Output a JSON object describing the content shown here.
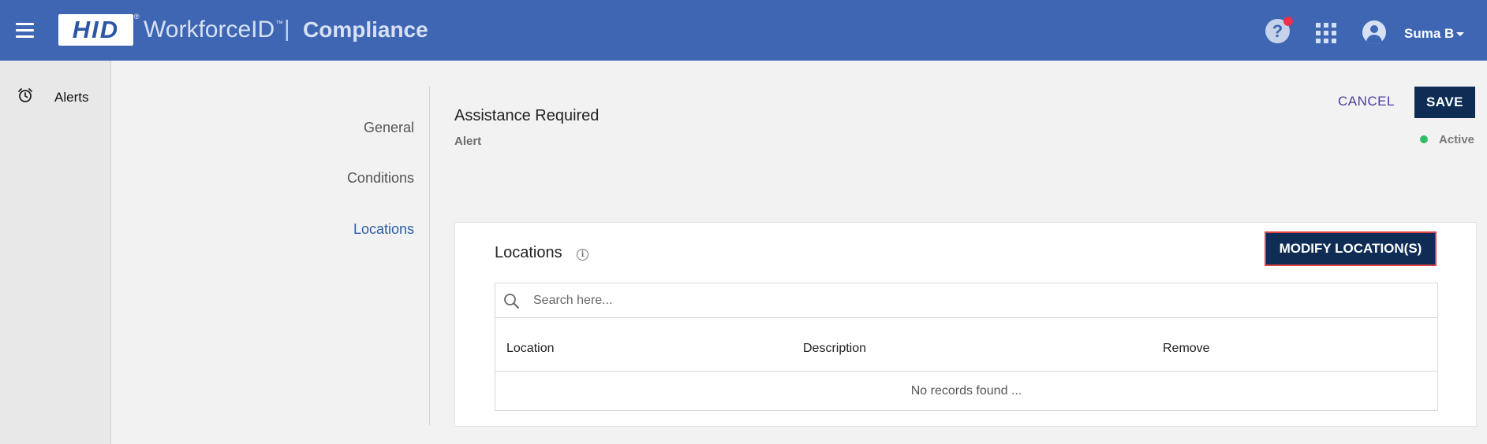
{
  "header": {
    "logo_text": "HID",
    "logo_reg": "®",
    "brand": "WorkforceID",
    "brand_tm": "™",
    "separator": "|",
    "module": "Compliance",
    "help_glyph": "?",
    "user_name": "Suma B",
    "colors": {
      "bar": "#3e66b3",
      "notification": "#ee2e4b"
    }
  },
  "sidebar": {
    "items": [
      {
        "label": "Alerts",
        "icon": "alarm-clock-icon"
      }
    ]
  },
  "section_nav": {
    "items": [
      {
        "label": "General",
        "active": false
      },
      {
        "label": "Conditions",
        "active": false
      },
      {
        "label": "Locations",
        "active": true
      }
    ]
  },
  "record": {
    "title": "Assistance Required",
    "type": "Alert",
    "status": "Active",
    "status_color": "#2fbd65"
  },
  "actions": {
    "cancel_label": "CANCEL",
    "save_label": "SAVE"
  },
  "locations_card": {
    "title": "Locations",
    "info_glyph": "i",
    "modify_label": "MODIFY LOCATION(S)",
    "search_placeholder": "Search here...",
    "columns": [
      "Location",
      "Description",
      "Remove"
    ],
    "empty_text": "No records found ..."
  }
}
